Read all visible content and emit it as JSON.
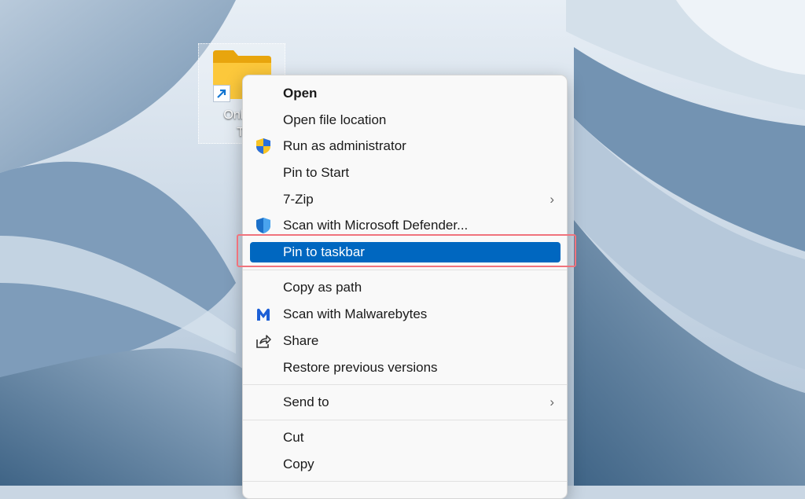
{
  "desktop": {
    "icon": {
      "label_line1": "Online",
      "label_line2": "Ti",
      "folder_icon": "folder-icon",
      "shortcut_icon": "shortcut-arrow-icon"
    }
  },
  "context_menu": {
    "items": [
      {
        "label": "Open",
        "icon": null
      },
      {
        "label": "Open file location",
        "icon": null
      },
      {
        "label": "Run as administrator",
        "icon": "uac-shield-icon"
      },
      {
        "label": "Pin to Start",
        "icon": null
      },
      {
        "label": "7-Zip",
        "icon": null,
        "submenu": true
      },
      {
        "label": "Scan with Microsoft Defender...",
        "icon": "defender-shield-icon"
      },
      {
        "label": "Pin to taskbar",
        "icon": null,
        "highlighted": true
      },
      {
        "label": "Copy as path",
        "icon": null
      },
      {
        "label": "Scan with Malwarebytes",
        "icon": "malwarebytes-icon"
      },
      {
        "label": "Share",
        "icon": "share-icon"
      },
      {
        "label": "Restore previous versions",
        "icon": null
      },
      {
        "label": "Send to",
        "icon": null,
        "submenu": true
      },
      {
        "label": "Cut",
        "icon": null
      },
      {
        "label": "Copy",
        "icon": null
      }
    ],
    "submenu_glyph": "›",
    "highlight_color": "#0067c0",
    "callout_color": "#f0737d"
  }
}
